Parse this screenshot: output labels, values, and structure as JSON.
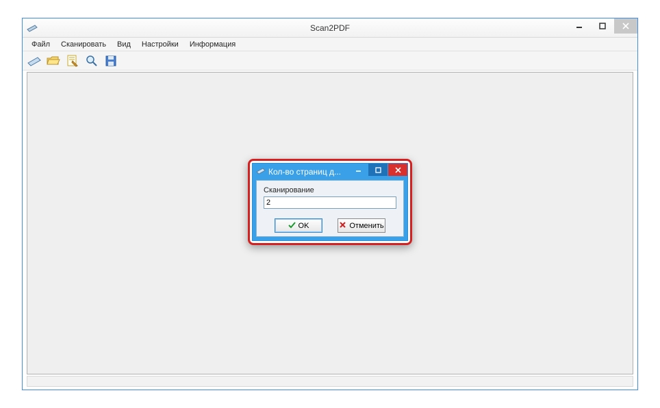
{
  "window": {
    "title": "Scan2PDF"
  },
  "menu": {
    "items": [
      "Файл",
      "Сканировать",
      "Вид",
      "Настройки",
      "Информация"
    ]
  },
  "toolbar": {
    "icons": [
      "scanner-icon",
      "folder-open-icon",
      "page-edit-icon",
      "magnifier-icon",
      "save-disk-icon"
    ]
  },
  "dialog": {
    "title": "Кол-во страниц д...",
    "label": "Сканирование",
    "value": "2",
    "ok_label": "OK",
    "cancel_label": "Отменить"
  },
  "colors": {
    "highlight_border": "#d42020",
    "dialog_blue": "#3aa0e8",
    "close_red": "#d9302e"
  }
}
